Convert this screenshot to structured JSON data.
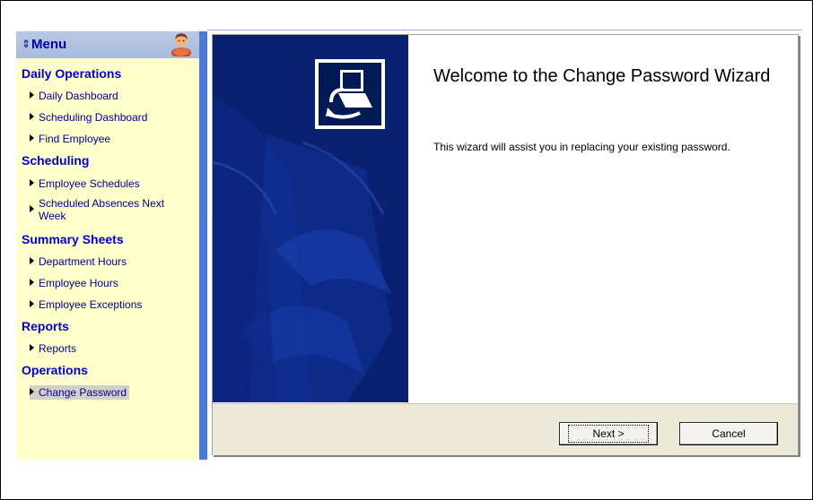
{
  "menu": {
    "title": "Menu",
    "arrows": "⇕"
  },
  "sidebar": {
    "sections": [
      {
        "title": "Daily Operations",
        "items": [
          "Daily Dashboard",
          "Scheduling Dashboard",
          "Find Employee"
        ]
      },
      {
        "title": "Scheduling",
        "items": [
          "Employee Schedules",
          "Scheduled Absences Next Week"
        ]
      },
      {
        "title": "Summary Sheets",
        "items": [
          "Department Hours",
          "Employee Hours",
          "Employee Exceptions"
        ]
      },
      {
        "title": "Reports",
        "items": [
          "Reports"
        ]
      },
      {
        "title": "Operations",
        "items": [
          "Change Password"
        ]
      }
    ],
    "selected_item": "Change Password"
  },
  "wizard": {
    "title": "Welcome to the Change Password Wizard",
    "description": "This wizard will assist you in replacing your existing password.",
    "next_label": "Next >",
    "cancel_label": "Cancel"
  },
  "colors": {
    "sidebar_bg": "#ffffcc",
    "section_title": "#0000cc",
    "banner": "#0a2070",
    "divider": "#4a7bd6"
  }
}
